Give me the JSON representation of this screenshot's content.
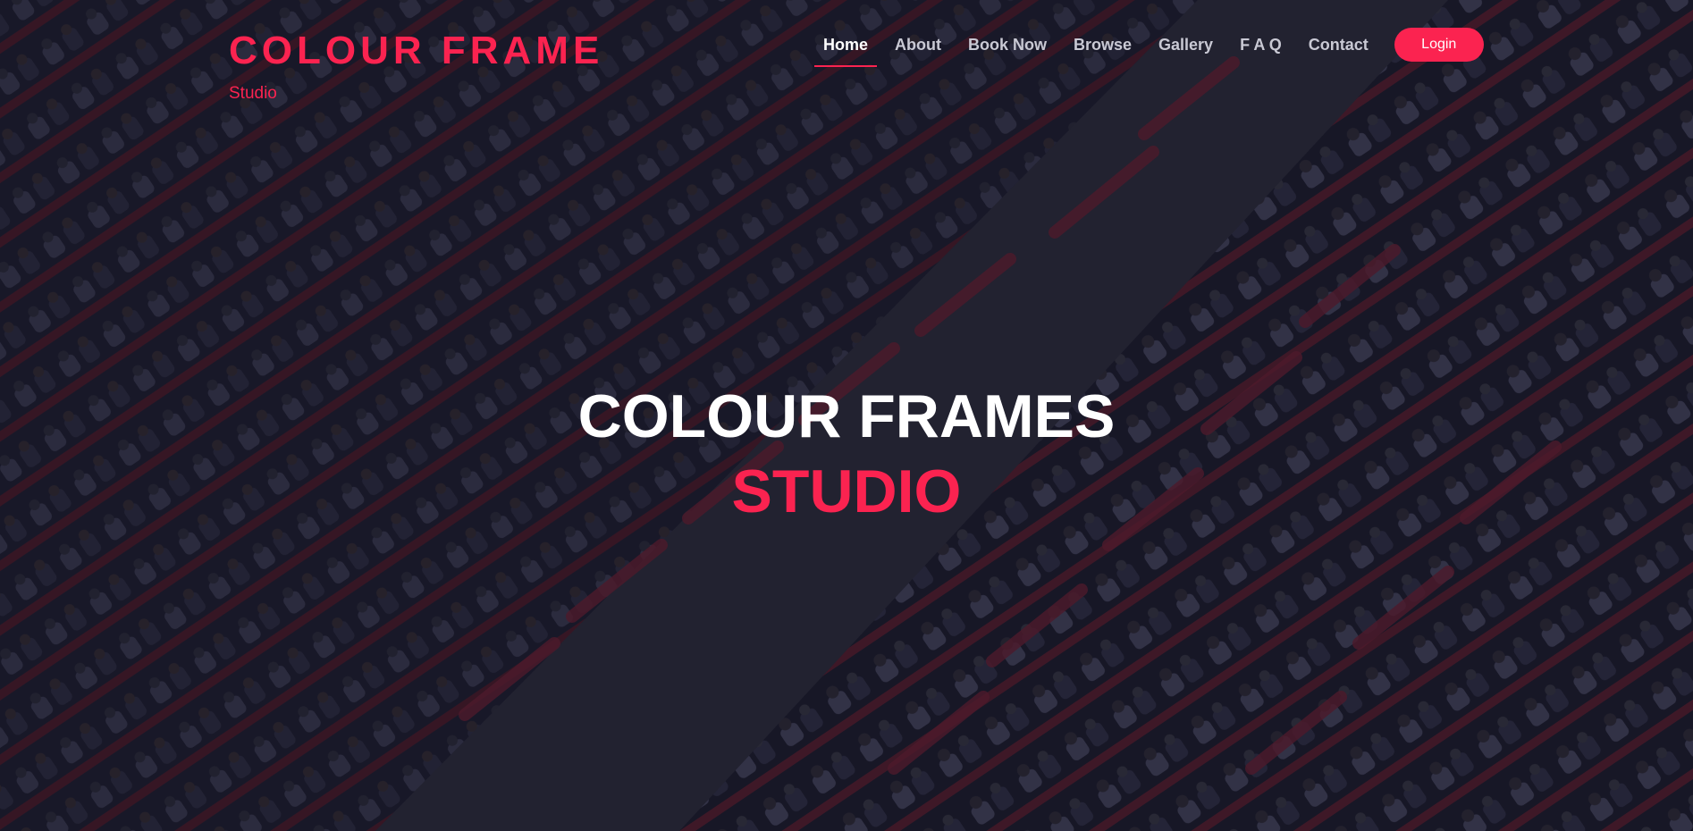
{
  "logo": {
    "title": "COLOUR FRAME",
    "subtitle": "Studio"
  },
  "nav": {
    "items": [
      {
        "label": "Home",
        "active": true
      },
      {
        "label": "About",
        "active": false
      },
      {
        "label": "Book Now",
        "active": false
      },
      {
        "label": "Browse",
        "active": false
      },
      {
        "label": "Gallery",
        "active": false
      },
      {
        "label": "F A Q",
        "active": false
      },
      {
        "label": "Contact",
        "active": false
      }
    ],
    "login_label": "Login"
  },
  "hero": {
    "line1": "COLOUR FRAMES",
    "line2": "STUDIO",
    "background": "auditorium-audience-photo"
  },
  "colors": {
    "accent": "#fb2350",
    "text_light": "#ffffff",
    "nav_muted": "#c9c9d4",
    "overlay": "#14141f"
  }
}
